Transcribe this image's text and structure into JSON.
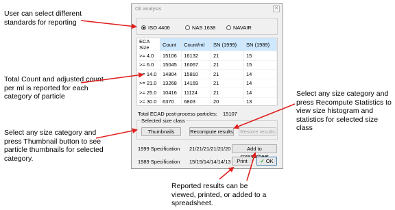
{
  "annotations": {
    "select_standards": [
      "User can select different",
      "standards for reporting"
    ],
    "total_count": [
      "Total Count and adjusted count",
      "per ml is reported for each",
      "category of particle"
    ],
    "thumbnails": [
      "Select any size category and",
      "press Thumbnail button to see",
      "particle thumbnails for selected",
      "category."
    ],
    "recompute": [
      "Select any size category and",
      "press Recompute Statistics to",
      "view size histogram and",
      "statistics for selected size class"
    ],
    "reported": [
      "Reported results can be",
      "viewed, printed, or added to a",
      "spreadsheet."
    ]
  },
  "dialog": {
    "title": "Oil analysis",
    "close_glyph": "✕",
    "standards": [
      {
        "label": "ISO 4406",
        "selected": true
      },
      {
        "label": "NAS 1638",
        "selected": false
      },
      {
        "label": "NAVAIR",
        "selected": false
      }
    ],
    "table": {
      "headers": [
        "ECA Size",
        "Count",
        "Count/ml",
        "SN (1999)",
        "SN (1989)"
      ],
      "rows": [
        [
          ">= 4.0",
          "15106",
          "16132",
          "21",
          "15"
        ],
        [
          ">= 6.0",
          "15045",
          "16067",
          "21",
          "15"
        ],
        [
          ">= 14.0",
          "14804",
          "15810",
          "21",
          "14"
        ],
        [
          ">= 21.0",
          "13268",
          "14169",
          "21",
          "14"
        ],
        [
          ">= 25.0",
          "10416",
          "11124",
          "21",
          "14"
        ],
        [
          ">= 30.0",
          "6370",
          "6803",
          "20",
          "13"
        ]
      ]
    },
    "total_label": "Total ECAD post-process particles:",
    "total_value": "15107",
    "size_class_label": "Selected size class",
    "buttons": {
      "thumbnails": "Thumbnails",
      "recompute": "Recompute results",
      "restore": "Restore results",
      "add_spreadsheet": "Add to spreadsheet",
      "print": "Print",
      "ok": "OK",
      "ok_check": "✓"
    },
    "spec_1999_label": "1999 Specification",
    "spec_1999_value": "21/21/21/21/21/20",
    "spec_1989_label": "1989 Specification",
    "spec_1989_value": "15/15/14/14/14/13"
  },
  "colors": {
    "arrow": "#e02020",
    "header_highlight": "#cde8ff"
  }
}
